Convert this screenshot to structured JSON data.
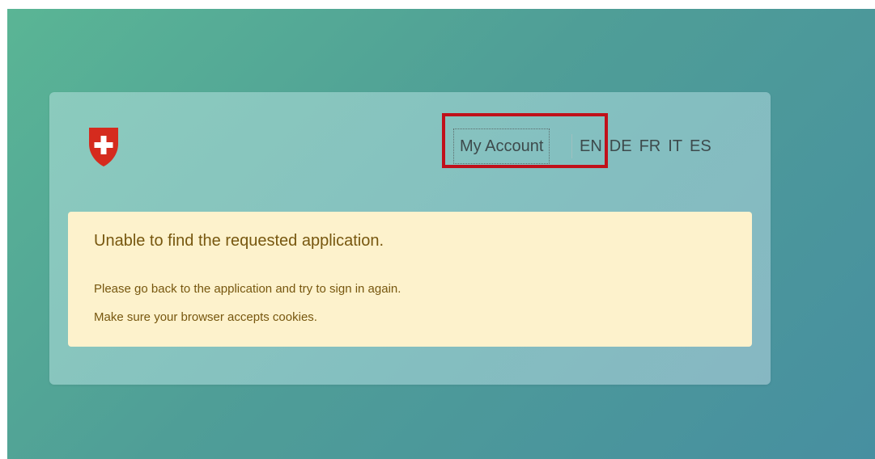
{
  "header": {
    "logo_icon": "swiss-cross-shield-icon",
    "my_account_label": "My Account",
    "languages": [
      "EN",
      "DE",
      "FR",
      "IT",
      "ES"
    ],
    "active_language": "EN"
  },
  "alert": {
    "title": "Unable to find the requested application.",
    "line1": "Please go back to the application and try to sign in again.",
    "line2": "Make sure your browser accepts cookies."
  },
  "colors": {
    "brand_red": "#d52b1e",
    "highlight_border": "#c0101a",
    "alert_background": "#fdf2cc",
    "alert_text": "#77570f"
  }
}
